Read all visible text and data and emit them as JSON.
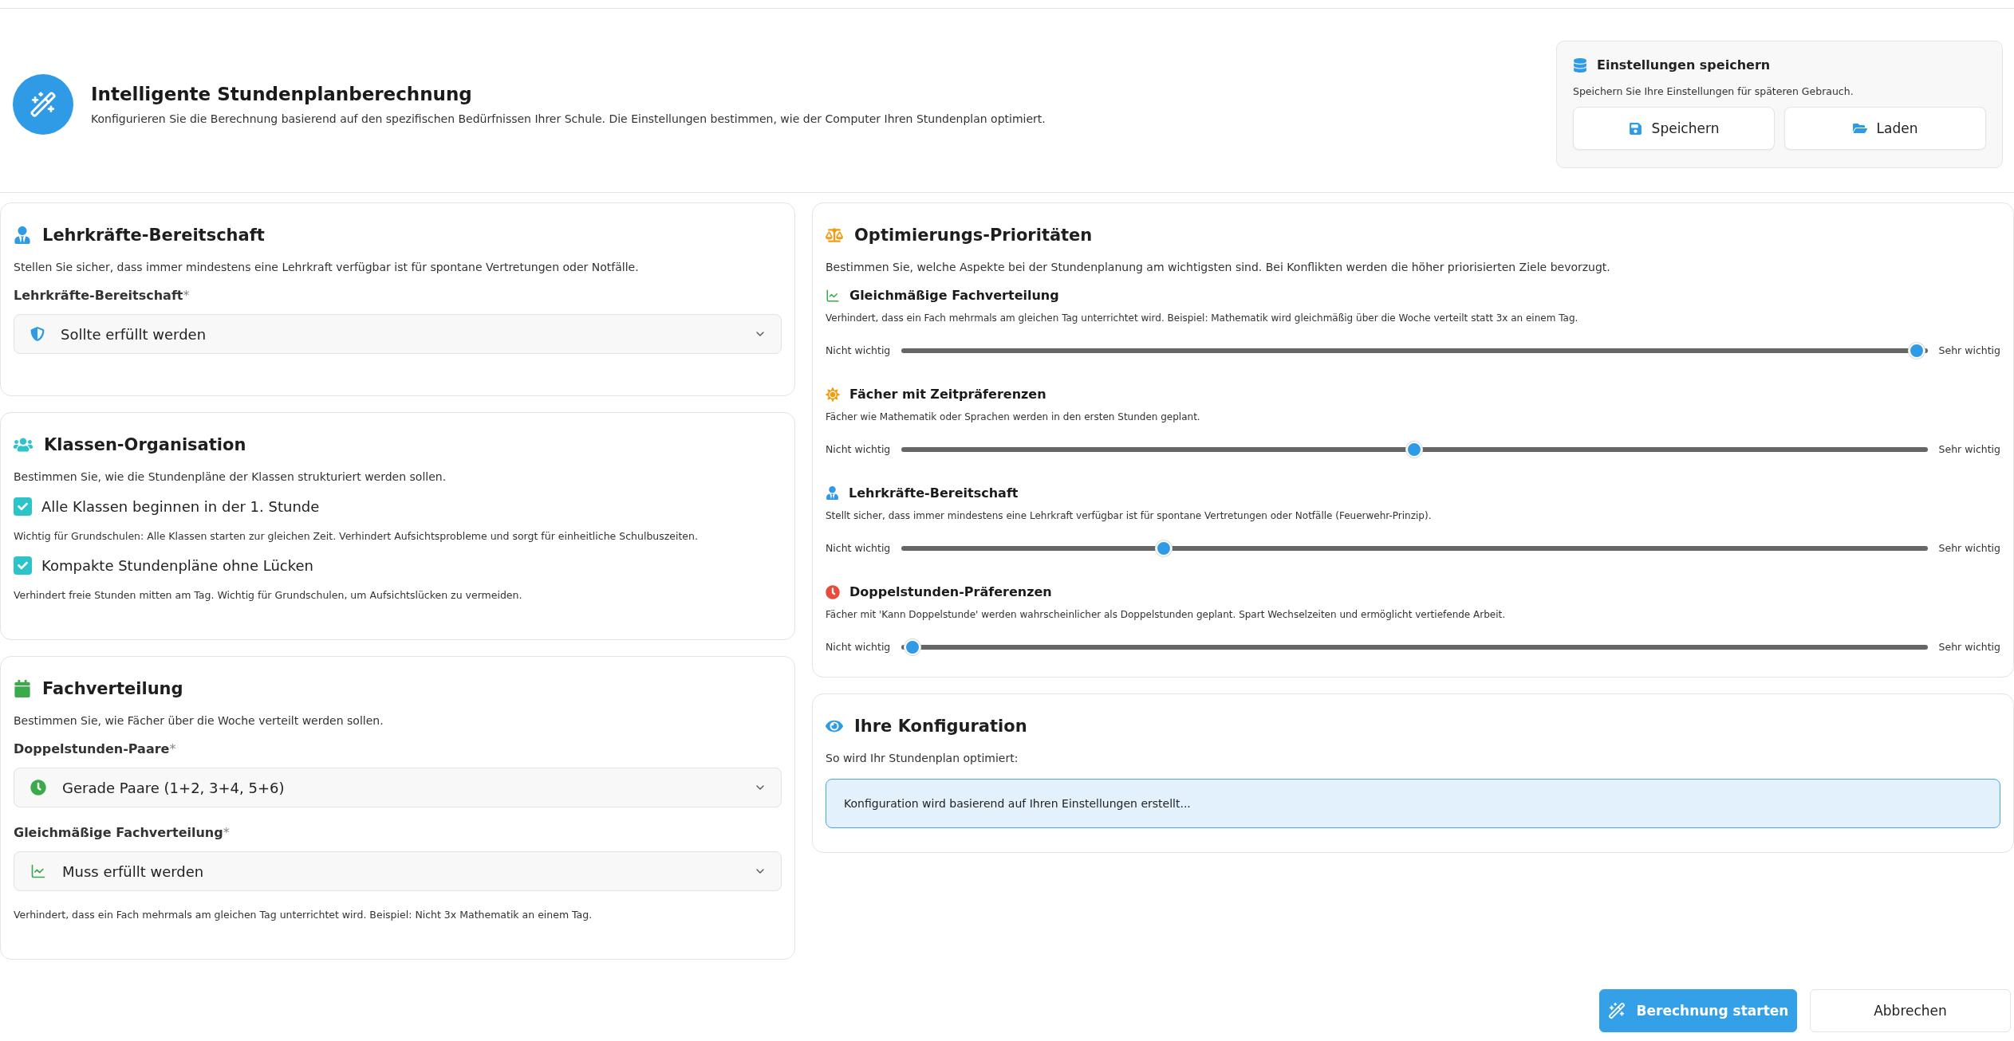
{
  "header": {
    "title": "Intelligente Stundenplanberechnung",
    "subtitle": "Konfigurieren Sie die Berechnung basierend auf den spezifischen Bedürfnissen Ihrer Schule. Die Einstellungen bestimmen, wie der Computer Ihren Stundenplan optimiert."
  },
  "save_panel": {
    "title": "Einstellungen speichern",
    "description": "Speichern Sie Ihre Einstellungen für späteren Gebrauch.",
    "buttons": [
      {
        "label": "Speichern",
        "kind": "save"
      },
      {
        "label": "Laden",
        "kind": "load"
      }
    ]
  },
  "teacher_standby": {
    "title": "Lehrkräfte-Bereitschaft",
    "description": "Stellen Sie sicher, dass immer mindestens eine Lehrkraft verfügbar ist für spontane Vertretungen oder Notfälle.",
    "field": {
      "label": "Lehrkräfte-Bereitschaft",
      "required_mark": "*",
      "value": "Sollte erfüllt werden"
    }
  },
  "class_organization": {
    "title": "Klassen-Organisation",
    "description": "Bestimmen Sie, wie die Stundenpläne der Klassen strukturiert werden sollen.",
    "options": [
      {
        "label": "Alle Klassen beginnen in der 1. Stunde",
        "checked": true,
        "hint": "Wichtig für Grundschulen: Alle Klassen starten zur gleichen Zeit. Verhindert Aufsichtsprobleme und sorgt für einheitliche Schulbuszeiten."
      },
      {
        "label": "Kompakte Stundenpläne ohne Lücken",
        "checked": true,
        "hint": "Verhindert freie Stunden mitten am Tag. Wichtig für Grundschulen, um Aufsichtslücken zu vermeiden."
      }
    ]
  },
  "subject_distribution": {
    "title": "Fachverteilung",
    "description": "Bestimmen Sie, wie Fächer über die Woche verteilt werden sollen.",
    "fields": [
      {
        "label": "Doppelstunden-Paare",
        "required_mark": "*",
        "value": "Gerade Paare (1+2, 3+4, 5+6)"
      },
      {
        "label": "Gleichmäßige Fachverteilung",
        "required_mark": "*",
        "value": "Muss erfüllt werden"
      }
    ],
    "hint": "Verhindert, dass ein Fach mehrmals am gleichen Tag unterrichtet wird. Beispiel: Nicht 3x Mathematik an einem Tag."
  },
  "priorities": {
    "title": "Optimierungs-Prioritäten",
    "description": "Bestimmen Sie, welche Aspekte bei der Stundenplanung am wichtigsten sind. Bei Konflikten werden die höher priorisierten Ziele bevorzugt.",
    "items": [
      {
        "title": "Gleichmäßige Fachverteilung",
        "description": "Verhindert, dass ein Fach mehrmals am gleichen Tag unterrichtet wird. Beispiel: Mathematik wird gleichmäßig über die Woche verteilt statt 3x an einem Tag.",
        "min_label": "Nicht wichtig",
        "max_label": "Sehr wichtig",
        "level": 1
      },
      {
        "title": "Fächer mit Zeitpräferenzen",
        "description": "Fächer wie Mathematik oder Sprachen werden in den ersten Stunden geplant.",
        "min_label": "Nicht wichtig",
        "max_label": "Sehr wichtig",
        "level": 0.5
      },
      {
        "title": "Lehrkräfte-Bereitschaft",
        "description": "Stellt sicher, dass immer mindestens eine Lehrkraft verfügbar ist für spontane Vertretungen oder Notfälle (Feuerwehr-Prinzip).",
        "min_label": "Nicht wichtig",
        "max_label": "Sehr wichtig",
        "level": 0.25
      },
      {
        "title": "Doppelstunden-Präferenzen",
        "description": "Fächer mit 'Kann Doppelstunde' werden wahrscheinlicher als Doppelstunden geplant. Spart Wechselzeiten und ermöglicht vertiefende Arbeit.",
        "min_label": "Nicht wichtig",
        "max_label": "Sehr wichtig",
        "level": 0
      }
    ]
  },
  "configuration": {
    "title": "Ihre Konfiguration",
    "description": "So wird Ihr Stundenplan optimiert:",
    "message": "Konfiguration wird basierend auf Ihren Einstellungen erstellt..."
  },
  "footer": {
    "buttons": [
      {
        "label": "Berechnung starten",
        "kind": "primary"
      },
      {
        "label": "Abbrechen",
        "kind": "secondary"
      }
    ]
  }
}
